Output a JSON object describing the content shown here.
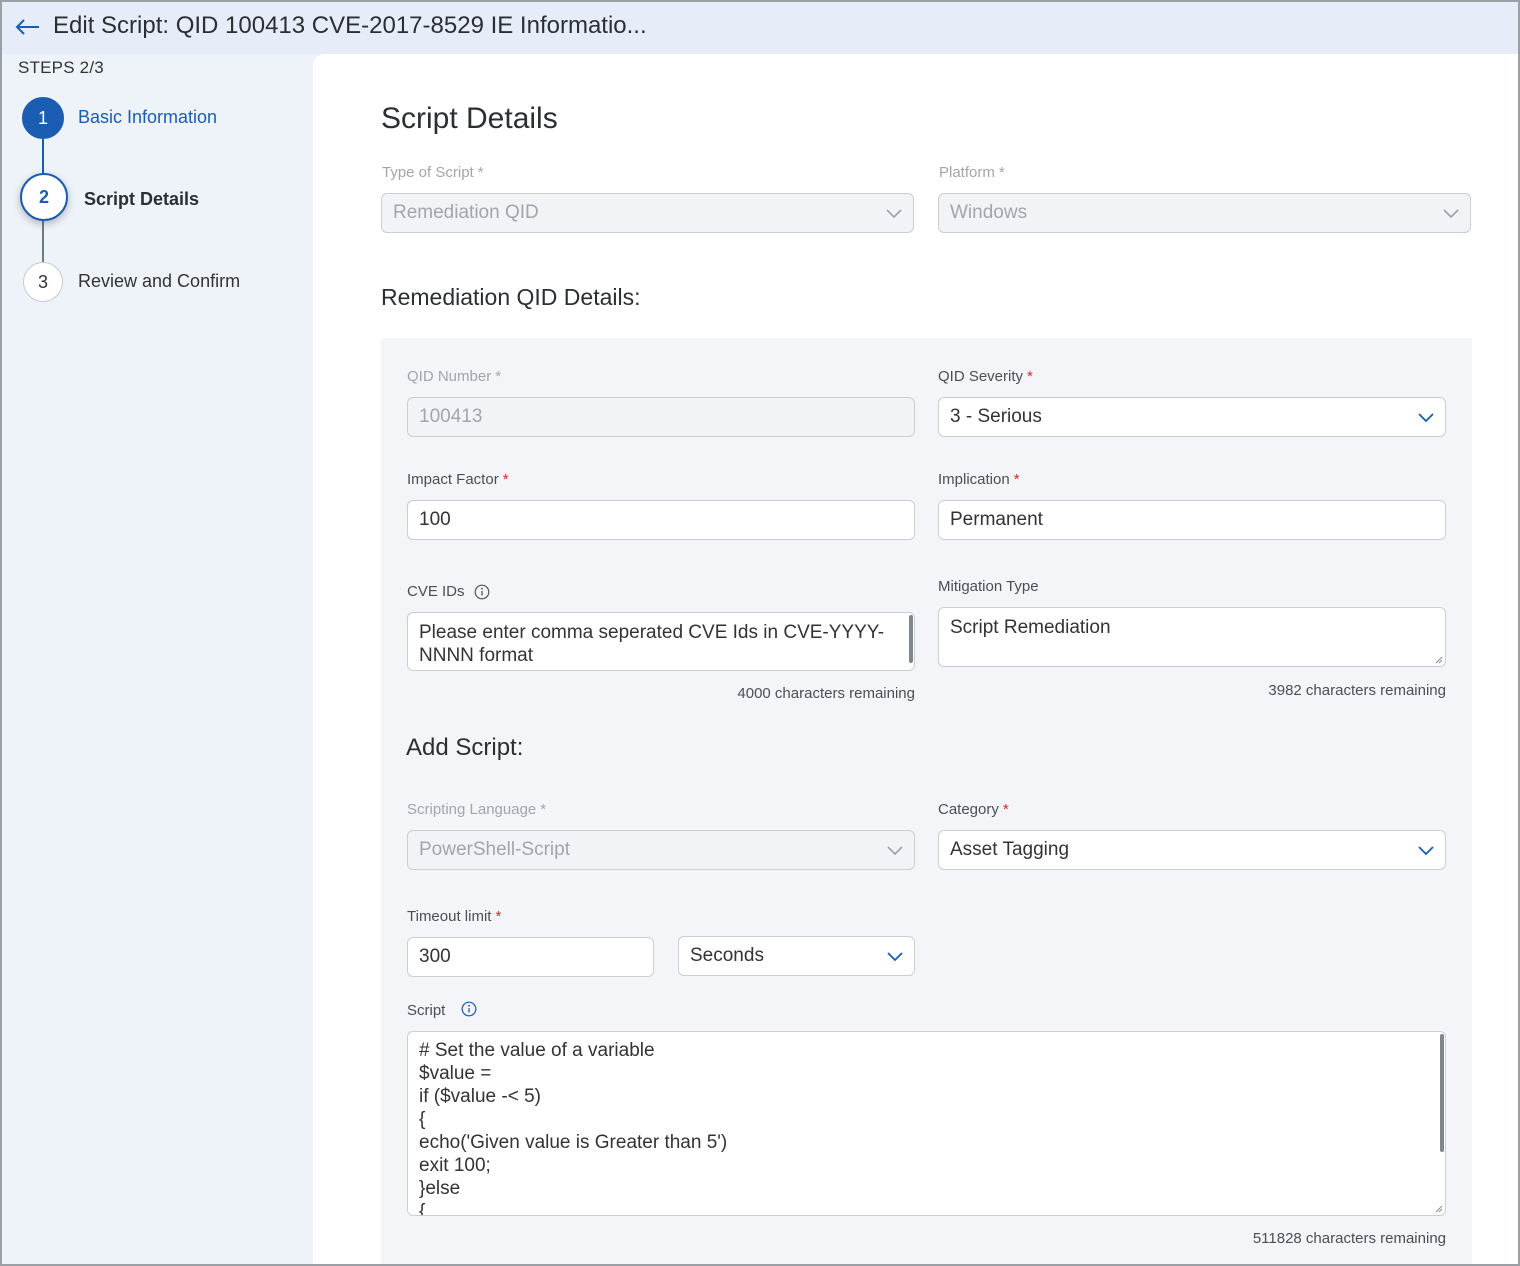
{
  "header": {
    "title": "Edit Script: QID 100413 CVE-2017-8529 IE Informatio..."
  },
  "steps": {
    "label": "STEPS 2/3",
    "items": [
      {
        "number": "1",
        "label": "Basic Information",
        "state": "completed"
      },
      {
        "number": "2",
        "label": "Script Details",
        "state": "active"
      },
      {
        "number": "3",
        "label": "Review and Confirm",
        "state": "pending"
      }
    ]
  },
  "script_details": {
    "title": "Script Details",
    "type_of_script": {
      "label": "Type of Script",
      "value": "Remediation QID",
      "required": "*"
    },
    "platform": {
      "label": "Platform",
      "value": "Windows",
      "required": "*"
    }
  },
  "remediation": {
    "title": "Remediation QID Details:",
    "qid_number": {
      "label": "QID Number",
      "value": "100413",
      "required": "*"
    },
    "qid_severity": {
      "label": "QID Severity",
      "value": "3 - Serious",
      "required": "*"
    },
    "impact_factor": {
      "label": "Impact Factor",
      "value": "100",
      "required": "*"
    },
    "implication": {
      "label": "Implication",
      "value": "Permanent",
      "required": "*"
    },
    "cve_ids": {
      "label": "CVE IDs",
      "placeholder": "Please enter comma seperated CVE Ids in CVE-YYYY-NNNN format",
      "remaining": "4000 characters remaining"
    },
    "mitigation_type": {
      "label": "Mitigation Type",
      "value": "Script Remediation",
      "remaining": "3982 characters remaining"
    }
  },
  "add_script": {
    "title": "Add Script:",
    "scripting_language": {
      "label": "Scripting Language",
      "value": "PowerShell-Script",
      "required": "*"
    },
    "category": {
      "label": "Category",
      "value": "Asset Tagging",
      "required": "*"
    },
    "timeout": {
      "label": "Timeout limit",
      "value": "300",
      "unit": "Seconds",
      "required": "*"
    },
    "script": {
      "label": "Script",
      "lines": [
        "# Set the value of a variable",
        "$value =",
        "if ($value -< 5)",
        "{",
        "echo('Given value is Greater than 5')",
        "exit 100;",
        "}else",
        "{"
      ],
      "remaining": "511828 characters remaining"
    }
  },
  "icons": {
    "back": "arrow-left-icon",
    "dropdown": "chevron-down-icon",
    "info": "info-icon"
  },
  "colors": {
    "accent": "#1a5db2",
    "required": "#d22b2b",
    "background": "#eef2f9"
  }
}
